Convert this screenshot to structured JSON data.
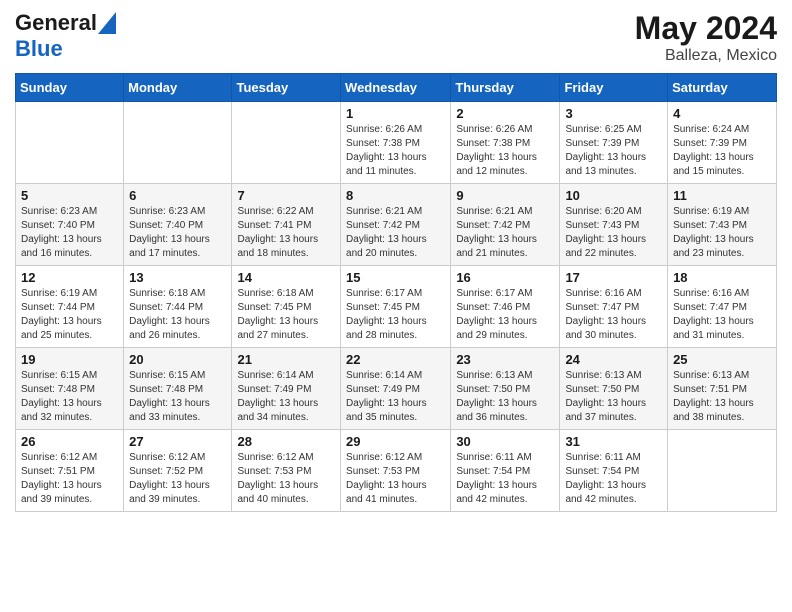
{
  "header": {
    "logo_line1": "General",
    "logo_line2": "Blue",
    "title": "May 2024",
    "location": "Balleza, Mexico"
  },
  "weekdays": [
    "Sunday",
    "Monday",
    "Tuesday",
    "Wednesday",
    "Thursday",
    "Friday",
    "Saturday"
  ],
  "weeks": [
    [
      {
        "day": "",
        "info": ""
      },
      {
        "day": "",
        "info": ""
      },
      {
        "day": "",
        "info": ""
      },
      {
        "day": "1",
        "info": "Sunrise: 6:26 AM\nSunset: 7:38 PM\nDaylight: 13 hours and 11 minutes."
      },
      {
        "day": "2",
        "info": "Sunrise: 6:26 AM\nSunset: 7:38 PM\nDaylight: 13 hours and 12 minutes."
      },
      {
        "day": "3",
        "info": "Sunrise: 6:25 AM\nSunset: 7:39 PM\nDaylight: 13 hours and 13 minutes."
      },
      {
        "day": "4",
        "info": "Sunrise: 6:24 AM\nSunset: 7:39 PM\nDaylight: 13 hours and 15 minutes."
      }
    ],
    [
      {
        "day": "5",
        "info": "Sunrise: 6:23 AM\nSunset: 7:40 PM\nDaylight: 13 hours and 16 minutes."
      },
      {
        "day": "6",
        "info": "Sunrise: 6:23 AM\nSunset: 7:40 PM\nDaylight: 13 hours and 17 minutes."
      },
      {
        "day": "7",
        "info": "Sunrise: 6:22 AM\nSunset: 7:41 PM\nDaylight: 13 hours and 18 minutes."
      },
      {
        "day": "8",
        "info": "Sunrise: 6:21 AM\nSunset: 7:42 PM\nDaylight: 13 hours and 20 minutes."
      },
      {
        "day": "9",
        "info": "Sunrise: 6:21 AM\nSunset: 7:42 PM\nDaylight: 13 hours and 21 minutes."
      },
      {
        "day": "10",
        "info": "Sunrise: 6:20 AM\nSunset: 7:43 PM\nDaylight: 13 hours and 22 minutes."
      },
      {
        "day": "11",
        "info": "Sunrise: 6:19 AM\nSunset: 7:43 PM\nDaylight: 13 hours and 23 minutes."
      }
    ],
    [
      {
        "day": "12",
        "info": "Sunrise: 6:19 AM\nSunset: 7:44 PM\nDaylight: 13 hours and 25 minutes."
      },
      {
        "day": "13",
        "info": "Sunrise: 6:18 AM\nSunset: 7:44 PM\nDaylight: 13 hours and 26 minutes."
      },
      {
        "day": "14",
        "info": "Sunrise: 6:18 AM\nSunset: 7:45 PM\nDaylight: 13 hours and 27 minutes."
      },
      {
        "day": "15",
        "info": "Sunrise: 6:17 AM\nSunset: 7:45 PM\nDaylight: 13 hours and 28 minutes."
      },
      {
        "day": "16",
        "info": "Sunrise: 6:17 AM\nSunset: 7:46 PM\nDaylight: 13 hours and 29 minutes."
      },
      {
        "day": "17",
        "info": "Sunrise: 6:16 AM\nSunset: 7:47 PM\nDaylight: 13 hours and 30 minutes."
      },
      {
        "day": "18",
        "info": "Sunrise: 6:16 AM\nSunset: 7:47 PM\nDaylight: 13 hours and 31 minutes."
      }
    ],
    [
      {
        "day": "19",
        "info": "Sunrise: 6:15 AM\nSunset: 7:48 PM\nDaylight: 13 hours and 32 minutes."
      },
      {
        "day": "20",
        "info": "Sunrise: 6:15 AM\nSunset: 7:48 PM\nDaylight: 13 hours and 33 minutes."
      },
      {
        "day": "21",
        "info": "Sunrise: 6:14 AM\nSunset: 7:49 PM\nDaylight: 13 hours and 34 minutes."
      },
      {
        "day": "22",
        "info": "Sunrise: 6:14 AM\nSunset: 7:49 PM\nDaylight: 13 hours and 35 minutes."
      },
      {
        "day": "23",
        "info": "Sunrise: 6:13 AM\nSunset: 7:50 PM\nDaylight: 13 hours and 36 minutes."
      },
      {
        "day": "24",
        "info": "Sunrise: 6:13 AM\nSunset: 7:50 PM\nDaylight: 13 hours and 37 minutes."
      },
      {
        "day": "25",
        "info": "Sunrise: 6:13 AM\nSunset: 7:51 PM\nDaylight: 13 hours and 38 minutes."
      }
    ],
    [
      {
        "day": "26",
        "info": "Sunrise: 6:12 AM\nSunset: 7:51 PM\nDaylight: 13 hours and 39 minutes."
      },
      {
        "day": "27",
        "info": "Sunrise: 6:12 AM\nSunset: 7:52 PM\nDaylight: 13 hours and 39 minutes."
      },
      {
        "day": "28",
        "info": "Sunrise: 6:12 AM\nSunset: 7:53 PM\nDaylight: 13 hours and 40 minutes."
      },
      {
        "day": "29",
        "info": "Sunrise: 6:12 AM\nSunset: 7:53 PM\nDaylight: 13 hours and 41 minutes."
      },
      {
        "day": "30",
        "info": "Sunrise: 6:11 AM\nSunset: 7:54 PM\nDaylight: 13 hours and 42 minutes."
      },
      {
        "day": "31",
        "info": "Sunrise: 6:11 AM\nSunset: 7:54 PM\nDaylight: 13 hours and 42 minutes."
      },
      {
        "day": "",
        "info": ""
      }
    ]
  ]
}
